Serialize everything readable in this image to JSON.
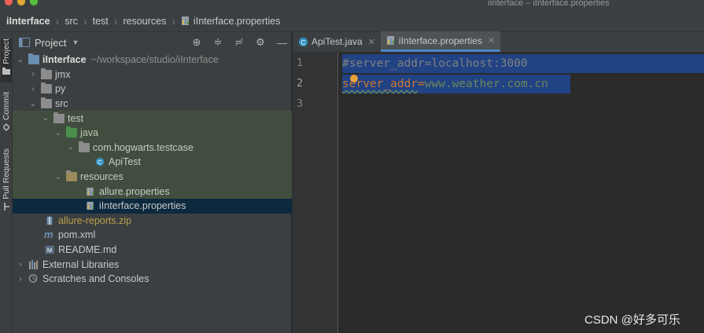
{
  "window": {
    "title": "iInterface – iInterface.properties",
    "traffic_lights": [
      "#ec5f57",
      "#e0a82e",
      "#55c13f"
    ]
  },
  "breadcrumb": [
    "iInterface",
    "src",
    "test",
    "resources",
    "iInterface.properties"
  ],
  "toolstrip": {
    "tabs": [
      "Project",
      "Commit",
      "Pull Requests"
    ]
  },
  "project_panel": {
    "title": "Project",
    "header_icons": [
      "locate-icon",
      "expand-all-icon",
      "collapse-all-icon",
      "gear-icon",
      "minimize-icon"
    ],
    "root": {
      "name": "iInterface",
      "path": "~/workspace/studio/iInterface"
    },
    "items": [
      {
        "name": "jmx"
      },
      {
        "name": "py"
      },
      {
        "name": "src"
      },
      {
        "name": "test"
      },
      {
        "name": "java"
      },
      {
        "name": "com.hogwarts.testcase"
      },
      {
        "name": "ApiTest"
      },
      {
        "name": "resources"
      },
      {
        "name": "allure.properties"
      },
      {
        "name": "iInterface.properties"
      },
      {
        "name": "allure-reports.zip"
      },
      {
        "name": "pom.xml"
      },
      {
        "name": "README.md"
      },
      {
        "name": "External Libraries"
      },
      {
        "name": "Scratches and Consoles"
      }
    ]
  },
  "editor": {
    "tabs": [
      {
        "label": "ApiTest.java",
        "active": false
      },
      {
        "label": "iInterface.properties",
        "active": true
      }
    ],
    "line_numbers": [
      "1",
      "2",
      "3"
    ],
    "lines": {
      "line1": "#server_addr=localhost:3000",
      "line2_key": "server_addr",
      "line2_eq": "=",
      "line2_val": "www.weather.com.cn"
    }
  },
  "watermark": "CSDN @好多可乐",
  "colors": {
    "selection": "#214283",
    "accent": "#4a88c7",
    "string": "#6a8759",
    "keyword": "#cc7832"
  }
}
